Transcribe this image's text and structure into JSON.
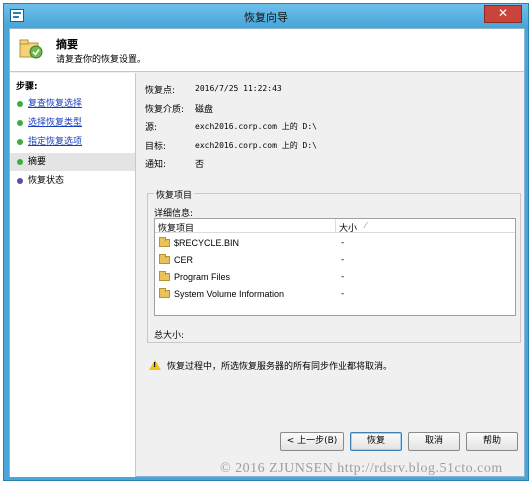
{
  "window": {
    "title": "恢复向导",
    "close_label": "✕"
  },
  "header": {
    "title": "摘要",
    "subtitle": "请复查你的恢复设置。"
  },
  "steps": {
    "heading": "步骤:",
    "items": [
      {
        "label": "复查恢复选择",
        "state": "link"
      },
      {
        "label": "选择恢复类型",
        "state": "link"
      },
      {
        "label": "指定恢复选项",
        "state": "link"
      },
      {
        "label": "摘要",
        "state": "current"
      },
      {
        "label": "恢复状态",
        "state": "pending"
      }
    ]
  },
  "summary": {
    "fields": [
      {
        "label": "恢复点:",
        "value": "2016/7/25 11:22:43"
      },
      {
        "label": "恢复介质:",
        "value": "磁盘"
      },
      {
        "label": "源:",
        "value": "exch2016.corp.com 上的 D:\\"
      },
      {
        "label": "目标:",
        "value": "exch2016.corp.com 上的 D:\\"
      },
      {
        "label": "通知:",
        "value": "否"
      }
    ]
  },
  "recovery_items": {
    "group_title": "恢复项目",
    "detail_label": "详细信息:",
    "columns": [
      "恢复项目",
      "大小"
    ],
    "rows": [
      {
        "name": "$RECYCLE.BIN",
        "size": "-"
      },
      {
        "name": "CER",
        "size": "-"
      },
      {
        "name": "Program Files",
        "size": "-"
      },
      {
        "name": "System Volume Information",
        "size": "-"
      }
    ],
    "total_label": "总大小:"
  },
  "warning": {
    "text": "恢复过程中，所选恢复服务器的所有同步作业都将取消。"
  },
  "buttons": {
    "back": "< 上一步(B)",
    "recover": "恢复",
    "cancel": "取消",
    "help": "帮助"
  },
  "watermark": "© 2016 ZJUNSEN http://rdsrv.blog.51cto.com"
}
